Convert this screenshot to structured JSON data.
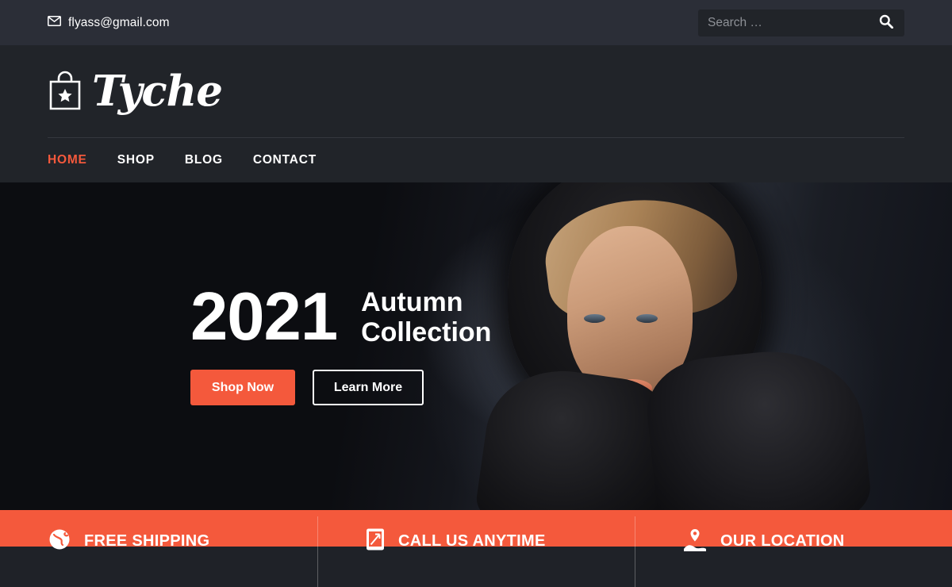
{
  "topbar": {
    "email": "flyass@gmail.com",
    "email_icon": "mail-icon",
    "search": {
      "placeholder": "Search …",
      "value": "",
      "button_icon": "search-icon"
    }
  },
  "header": {
    "logo": {
      "icon": "shopping-bag-icon",
      "text": "Tyche"
    },
    "nav": [
      {
        "label": "HOME",
        "active": true
      },
      {
        "label": "SHOP",
        "active": false
      },
      {
        "label": "BLOG",
        "active": false
      },
      {
        "label": "CONTACT",
        "active": false
      }
    ]
  },
  "hero": {
    "year": "2021",
    "subtitle": "Autumn\nCollection",
    "primary_button": "Shop Now",
    "secondary_button": "Learn More"
  },
  "features": [
    {
      "icon": "globe-icon",
      "title": "FREE SHIPPING"
    },
    {
      "icon": "mobile-phone-icon",
      "title": "CALL US ANYTIME"
    },
    {
      "icon": "map-marker-icon",
      "title": "OUR LOCATION"
    }
  ],
  "colors": {
    "accent": "#f4593c",
    "topbar_bg": "#2b2e37",
    "header_bg": "#212429",
    "hero_bg": "#0d0e12",
    "text_light": "#ffffff"
  }
}
